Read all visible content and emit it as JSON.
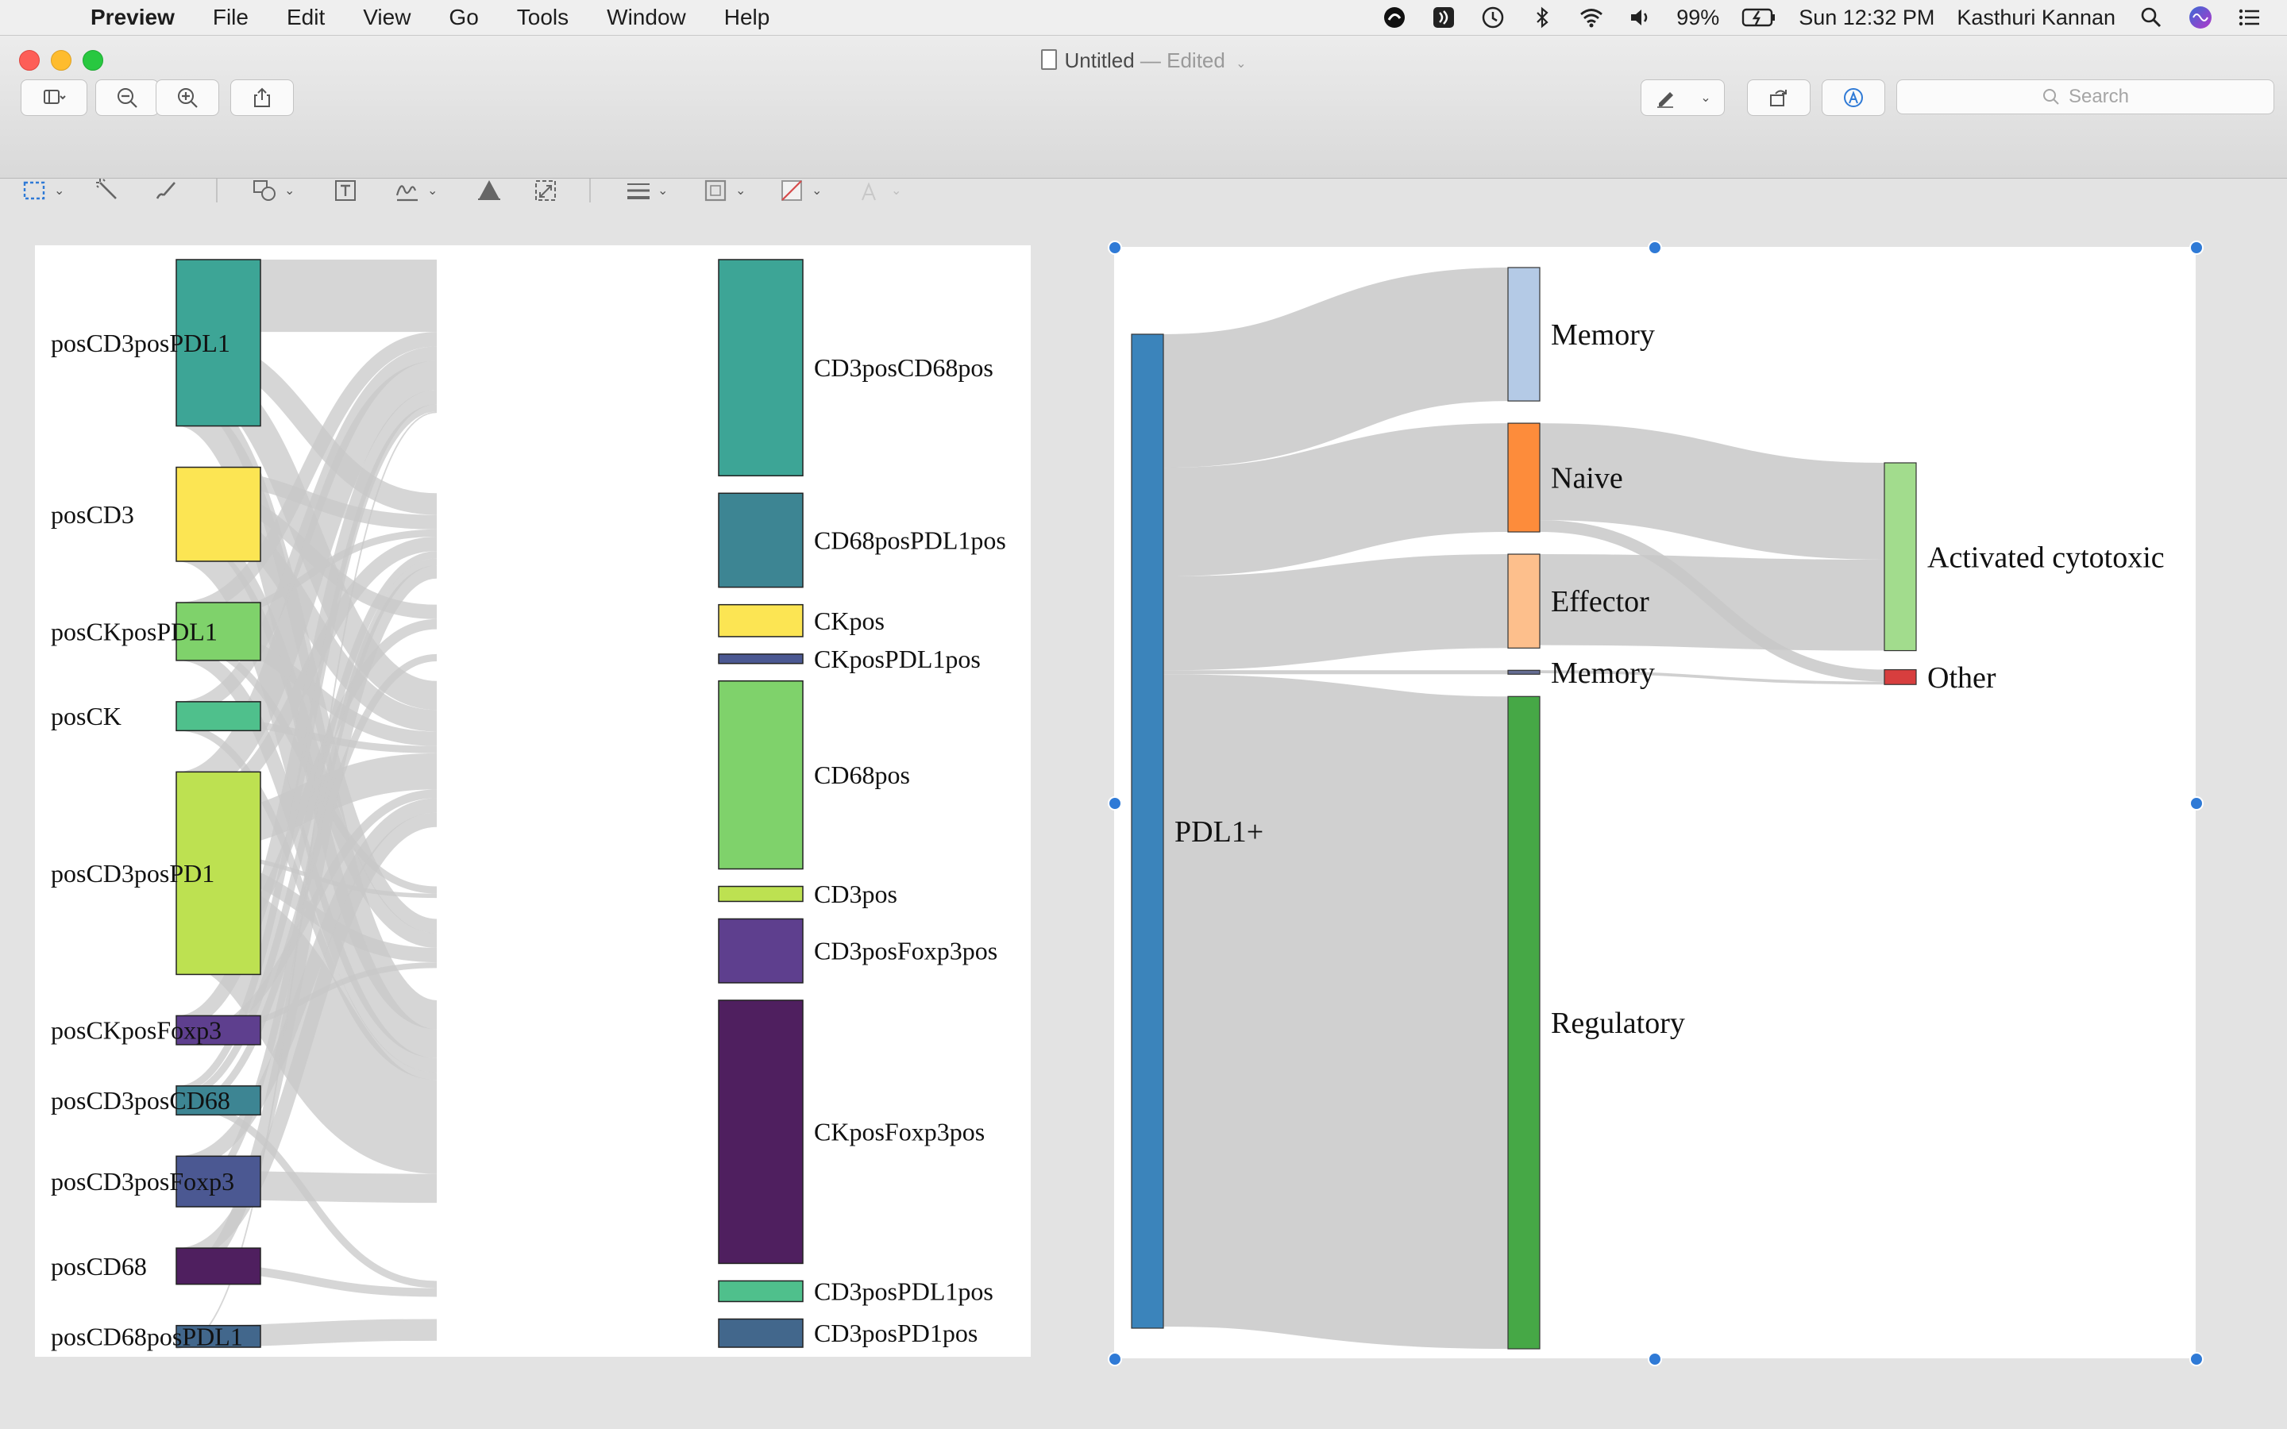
{
  "menubar": {
    "app": "Preview",
    "items": [
      "File",
      "Edit",
      "View",
      "Go",
      "Tools",
      "Window",
      "Help"
    ],
    "battery": "99%",
    "clock": "Sun 12:32 PM",
    "user": "Kasthuri Kannan"
  },
  "window": {
    "title": "Untitled",
    "title_sep": " — ",
    "status": "Edited",
    "search_placeholder": "Search"
  },
  "colors": {
    "link": "#c8c8c8",
    "selection": "#2f7ad6"
  },
  "chart_data": [
    {
      "type": "sankey",
      "sources": [
        {
          "name": "posCD3posPDL1",
          "color": "#3da596",
          "value": 11.5
        },
        {
          "name": "posCD3",
          "color": "#fce553",
          "value": 6.5
        },
        {
          "name": "posCKposPDL1",
          "color": "#7fd26b",
          "value": 4
        },
        {
          "name": "posCK",
          "color": "#4fc08c",
          "value": 2
        },
        {
          "name": "posCD3posPD1",
          "color": "#bde151",
          "value": 14
        },
        {
          "name": "posCKposFoxp3",
          "color": "#5e3f8e",
          "value": 2
        },
        {
          "name": "posCD3posCD68",
          "color": "#3d8593",
          "value": 2
        },
        {
          "name": "posCD3posFoxp3",
          "color": "#4b5892",
          "value": 3.5
        },
        {
          "name": "posCD68",
          "color": "#4f1f5f",
          "value": 2.5
        },
        {
          "name": "posCD68posPDL1",
          "color": "#42678c",
          "value": 1.5
        }
      ],
      "targets": [
        {
          "name": "CD3posCD68pos",
          "color": "#3da596",
          "value": 11.5
        },
        {
          "name": "CD68posPDL1pos",
          "color": "#3d8593",
          "value": 5
        },
        {
          "name": "CKpos",
          "color": "#fce553",
          "value": 1.7
        },
        {
          "name": "CKposPDL1pos",
          "color": "#4b5892",
          "value": 0.5
        },
        {
          "name": "CD68pos",
          "color": "#7fd26b",
          "value": 10
        },
        {
          "name": "CD3pos",
          "color": "#bde151",
          "value": 0.8
        },
        {
          "name": "CD3posFoxp3pos",
          "color": "#5e3f8e",
          "value": 3.4
        },
        {
          "name": "CKposFoxp3pos",
          "color": "#4f1f5f",
          "value": 14
        },
        {
          "name": "CD3posPDL1pos",
          "color": "#4fc08c",
          "value": 1.1
        },
        {
          "name": "CD3posPD1pos",
          "color": "#42678c",
          "value": 1.5
        }
      ],
      "links": [
        {
          "source": "posCD3posPDL1",
          "target": "CD3posCD68pos",
          "value": 5
        },
        {
          "source": "posCD3posPDL1",
          "target": "CD68posPDL1pos",
          "value": 1.5
        },
        {
          "source": "posCD3posPDL1",
          "target": "CD68pos",
          "value": 2
        },
        {
          "source": "posCD3posPDL1",
          "target": "CD3posFoxp3pos",
          "value": 1
        },
        {
          "source": "posCD3posPDL1",
          "target": "CKposFoxp3pos",
          "value": 2
        },
        {
          "source": "posCD3",
          "target": "CD68posPDL1pos",
          "value": 1
        },
        {
          "source": "posCD3",
          "target": "CKpos",
          "value": 1
        },
        {
          "source": "posCD3",
          "target": "CD68pos",
          "value": 1.5
        },
        {
          "source": "posCD3",
          "target": "CD3posFoxp3pos",
          "value": 1
        },
        {
          "source": "posCD3",
          "target": "CKposFoxp3pos",
          "value": 2
        },
        {
          "source": "posCKposPDL1",
          "target": "CD3posCD68pos",
          "value": 1
        },
        {
          "source": "posCKposPDL1",
          "target": "CD68posPDL1pos",
          "value": 0.5
        },
        {
          "source": "posCKposPDL1",
          "target": "CD68pos",
          "value": 1
        },
        {
          "source": "posCKposPDL1",
          "target": "CD3pos",
          "value": 0.5
        },
        {
          "source": "posCKposPDL1",
          "target": "CKposFoxp3pos",
          "value": 1
        },
        {
          "source": "posCK",
          "target": "CD3posCD68pos",
          "value": 1
        },
        {
          "source": "posCK",
          "target": "CD68pos",
          "value": 0.5
        },
        {
          "source": "posCK",
          "target": "CKposFoxp3pos",
          "value": 0.5
        },
        {
          "source": "posCD3posPD1",
          "target": "CD3posCD68pos",
          "value": 2
        },
        {
          "source": "posCD3posPD1",
          "target": "CD68posPDL1pos",
          "value": 1
        },
        {
          "source": "posCD3posPD1",
          "target": "CD68pos",
          "value": 2.5
        },
        {
          "source": "posCD3posPD1",
          "target": "CD3pos",
          "value": 0.3
        },
        {
          "source": "posCD3posPD1",
          "target": "CD3posFoxp3pos",
          "value": 1
        },
        {
          "source": "posCD3posPD1",
          "target": "CKposFoxp3pos",
          "value": 6.5
        },
        {
          "source": "posCD3posPD1",
          "target": "CKpos",
          "value": 0.7
        },
        {
          "source": "posCKposFoxp3",
          "target": "CD3posCD68pos",
          "value": 1
        },
        {
          "source": "posCKposFoxp3",
          "target": "CD3posFoxp3pos",
          "value": 0.4
        },
        {
          "source": "posCKposFoxp3",
          "target": "CD68pos",
          "value": 0.6
        },
        {
          "source": "posCD3posCD68",
          "target": "CD3posCD68pos",
          "value": 0.5
        },
        {
          "source": "posCD3posCD68",
          "target": "CD68posPDL1pos",
          "value": 0.5
        },
        {
          "source": "posCD3posCD68",
          "target": "CD3posPDL1pos",
          "value": 0.5
        },
        {
          "source": "posCD3posCD68",
          "target": "CKposPDL1pos",
          "value": 0.5
        },
        {
          "source": "posCD3posFoxp3",
          "target": "CD68pos",
          "value": 1
        },
        {
          "source": "posCD3posFoxp3",
          "target": "CKposFoxp3pos",
          "value": 2
        },
        {
          "source": "posCD3posFoxp3",
          "target": "CD68posPDL1pos",
          "value": 0.5
        },
        {
          "source": "posCD68",
          "target": "CD68pos",
          "value": 1
        },
        {
          "source": "posCD68",
          "target": "CD3posPDL1pos",
          "value": 0.6
        },
        {
          "source": "posCD68",
          "target": "CD68posPDL1pos",
          "value": 0.9
        },
        {
          "source": "posCD68posPDL1",
          "target": "CD3posPD1pos",
          "value": 1.5
        },
        {
          "source": "posCD68posPDL1",
          "target": "CD3posCD68pos",
          "value": 0.1
        }
      ]
    },
    {
      "type": "sankey",
      "columns": [
        [
          {
            "name": "PDL1+",
            "color": "#3b84bb",
            "value": 100
          }
        ],
        [
          {
            "name": "Memory",
            "color": "#b4cae6",
            "value": 13.5
          },
          {
            "name": "Naive",
            "color": "#fd8c3b",
            "value": 11
          },
          {
            "name": "Effector",
            "color": "#fdbf8c",
            "value": 9.5
          },
          {
            "name": "Memory",
            "color": "#646c92",
            "value": 0.4
          },
          {
            "name": "Regulatory",
            "color": "#46a846",
            "value": 66
          }
        ],
        [
          {
            "name": "Activated cytotoxic",
            "color": "#a2dc8d",
            "value": 19
          },
          {
            "name": "Other",
            "color": "#d73e3e",
            "value": 1.5
          }
        ]
      ],
      "links": [
        {
          "source": "PDL1+",
          "target": "Memory",
          "value": 13.5
        },
        {
          "source": "PDL1+",
          "target": "Naive",
          "value": 11
        },
        {
          "source": "PDL1+",
          "target": "Effector",
          "value": 9.5
        },
        {
          "source": "PDL1+",
          "target": "Memory (2)",
          "value": 0.4
        },
        {
          "source": "PDL1+",
          "target": "Regulatory",
          "value": 66
        },
        {
          "source": "Naive",
          "target": "Activated cytotoxic",
          "value": 9.8
        },
        {
          "source": "Naive",
          "target": "Other",
          "value": 1.2
        },
        {
          "source": "Effector",
          "target": "Activated cytotoxic",
          "value": 9.2
        },
        {
          "source": "Memory (2)",
          "target": "Other",
          "value": 0.3
        }
      ]
    }
  ]
}
